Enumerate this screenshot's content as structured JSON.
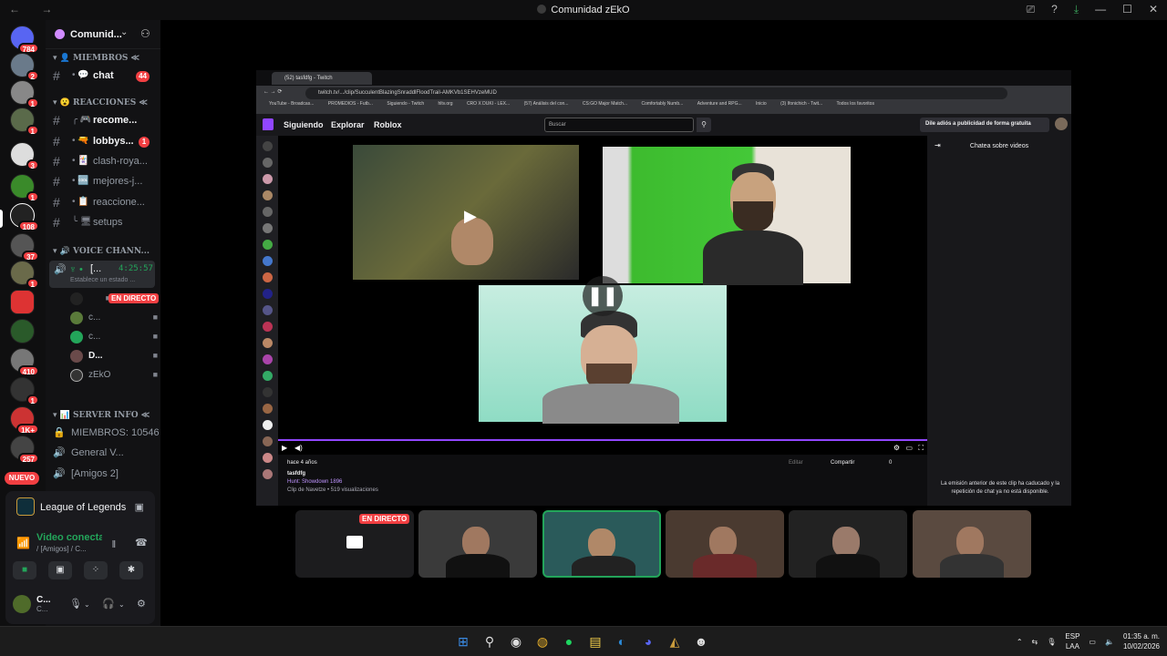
{
  "window": {
    "title": "Comunidad zEkO",
    "back": "←",
    "forward": "→",
    "controls": [
      "⎚",
      "?",
      "⤓",
      "—",
      "☐",
      "✕"
    ]
  },
  "rail": {
    "badges": [
      "784",
      "2",
      "1",
      "1",
      "3",
      "1",
      "108",
      "37",
      "1",
      "",
      "",
      "410",
      "1",
      "1K+",
      "257"
    ],
    "new_label": "NUEVO"
  },
  "server": {
    "name": "Comunid...",
    "chevron": "⌄",
    "add": "⚇"
  },
  "categories": {
    "miembros": "MIEMBROS ≪",
    "reacciones": "REACCIONES ≪",
    "voice": "VOICE CHANN...",
    "serverinfo": "Server Info ≪"
  },
  "channels": [
    {
      "name": "chat",
      "badge": "44"
    },
    {
      "name": "recome...",
      "badge": ""
    },
    {
      "name": "lobbys...",
      "badge": "1"
    },
    {
      "name": "clash-roya...",
      "badge": ""
    },
    {
      "name": "mejores-j...",
      "badge": ""
    },
    {
      "name": "reaccione...",
      "badge": ""
    },
    {
      "name": "setups",
      "badge": ""
    }
  ],
  "voice": {
    "channel": "[...",
    "time": "4:25:57",
    "sub": "Establece un estado ...",
    "live_label": "EN DIRECTO",
    "users": [
      "c...",
      "c...",
      "D...",
      "zEkO"
    ]
  },
  "server_info": [
    {
      "icon": "🔒",
      "label": "MIEMBROS: 10546"
    },
    {
      "icon": "🔊",
      "label": "General V..."
    },
    {
      "icon": "🔊",
      "label": "[Amigos 2]"
    }
  ],
  "activity": {
    "game": "League of Legends"
  },
  "voice_status": {
    "title": "Video conectad",
    "channel": "/ [Amigos] / C..."
  },
  "user": {
    "name": "C...",
    "status": "C..."
  },
  "browser": {
    "tab": "(52) tasfdfg - Twitch",
    "url": "twitch.tv/.../clip/SucculentBlazingSnraddlFloodTrail-AMKVb1SEHVzeMUD",
    "bookmarks": [
      "YouTube - Broadcas...",
      "PROMEDIOS - Futb...",
      "Siguiendo - Twitch",
      "hltv.org",
      "CRO X DUKI - LEX...",
      "(57) Análisis del con...",
      "CS:GO Major Match...",
      "Comfortably Numb...",
      "Adventure and RPG...",
      "Inicio",
      "(3) Ifonichich - Twit...",
      "Todos los favoritos"
    ]
  },
  "twitch": {
    "nav": [
      "Siguiendo",
      "Explorar",
      "Roblox"
    ],
    "search_placeholder": "Buscar",
    "ad_button": "Dile adiós a publicidad de forma gratuita",
    "chat_header": "Chatea sobre videos",
    "chat_msg": "La emisión anterior de este clip ha caducado y la repetición de chat ya no está disponible.",
    "clip_ago": "hace 4 años",
    "clip_title": "tasfdfg",
    "clip_game": "Hunt: Showdown 1896",
    "clip_by": "Clip de Navetze • 519 visualizaciones",
    "edit": "Editar",
    "share": "Compartir",
    "likes": "0"
  },
  "strip": {
    "live_label": "EN DIRECTO"
  },
  "taskbar": {
    "lang1": "ESP",
    "lang2": "LAA",
    "time": "01:35 a. m.",
    "date": "10/02/2026"
  }
}
